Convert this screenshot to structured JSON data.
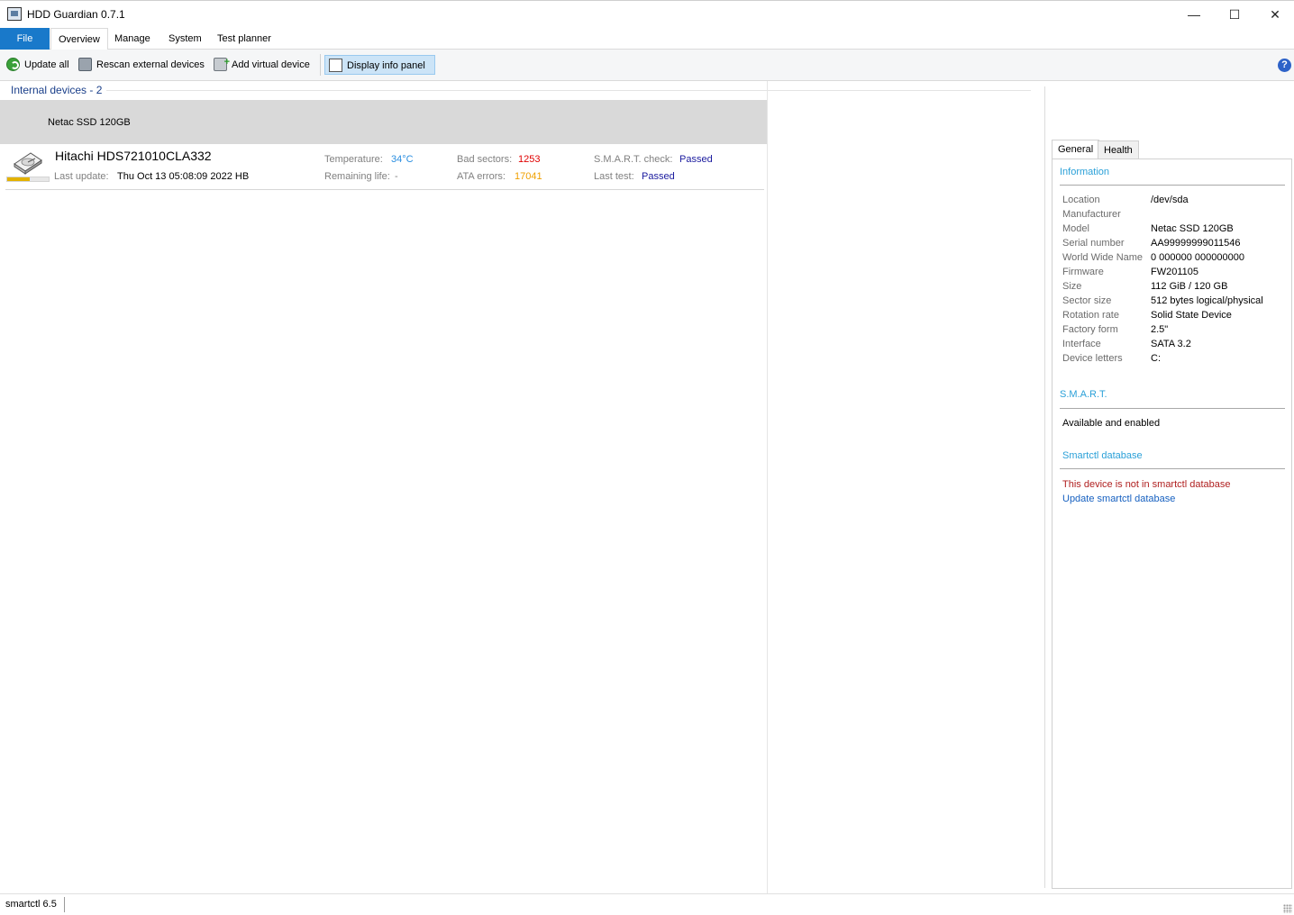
{
  "window": {
    "title": "HDD Guardian 0.7.1",
    "minimize_glyph": "—",
    "maximize_glyph": "☐",
    "close_glyph": "✕"
  },
  "menu": {
    "file": "File",
    "tabs": [
      "Overview",
      "Manage",
      "System",
      "Test planner"
    ],
    "active_tab": "Overview"
  },
  "toolbar": {
    "update_all": "Update all",
    "rescan": "Rescan external devices",
    "add_virtual": "Add virtual device",
    "display_info_panel": "Display info panel",
    "help_glyph": "?"
  },
  "devices": {
    "header": "Internal devices - 2",
    "selected_device": "Netac SSD 120GB",
    "hdd": {
      "name": "Hitachi HDS721010CLA332",
      "life_fraction": 0.55,
      "last_update_label": "Last update:",
      "last_update_value": "Thu Oct 13 05:08:09 2022 HB",
      "temperature_label": "Temperature:",
      "temperature_value": "34°C",
      "remaining_life_label": "Remaining life:",
      "remaining_life_value": "-",
      "bad_sectors_label": "Bad sectors:",
      "bad_sectors_value": "1253",
      "ata_errors_label": "ATA errors:",
      "ata_errors_value": "17041",
      "smart_check_label": "S.M.A.R.T. check:",
      "smart_check_value": "Passed",
      "last_test_label": "Last test:",
      "last_test_value": "Passed"
    }
  },
  "info_panel": {
    "tabs": [
      "General",
      "Health"
    ],
    "active_tab": "General",
    "information_title": "Information",
    "rows": [
      {
        "key": "Location",
        "value": "/dev/sda"
      },
      {
        "key": "Manufacturer",
        "value": ""
      },
      {
        "key": "Model",
        "value": "Netac SSD 120GB"
      },
      {
        "key": "Serial number",
        "value": "AA99999999011546"
      },
      {
        "key": "World Wide Name",
        "value": "0 000000 000000000"
      },
      {
        "key": "Firmware",
        "value": "FW201105"
      },
      {
        "key": "Size",
        "value": "112 GiB / 120 GB"
      },
      {
        "key": "Sector size",
        "value": "512 bytes logical/physical"
      },
      {
        "key": "Rotation rate",
        "value": "Solid State Device"
      },
      {
        "key": "Factory form",
        "value": "2.5\""
      },
      {
        "key": "Interface",
        "value": "SATA 3.2"
      },
      {
        "key": "Device letters",
        "value": "C:"
      }
    ],
    "smart_title": "S.M.A.R.T.",
    "smart_status": "Available and enabled",
    "smartctl_db_title": "Smartctl database",
    "smartctl_db_warning": "This device is not in smartctl database",
    "smartctl_db_update_link": "Update smartctl database"
  },
  "statusbar": {
    "text": "smartctl 6.5"
  },
  "colors": {
    "file_tab_bg": "#1979ca",
    "accent_blue": "#2aa0d8",
    "bad_red": "#e00000",
    "warn_orange": "#f0a000",
    "passed_navy": "#1a1a9e",
    "temp_blue": "#2a8ee0",
    "warning_text": "#b02020",
    "link_blue": "#1660c0"
  }
}
